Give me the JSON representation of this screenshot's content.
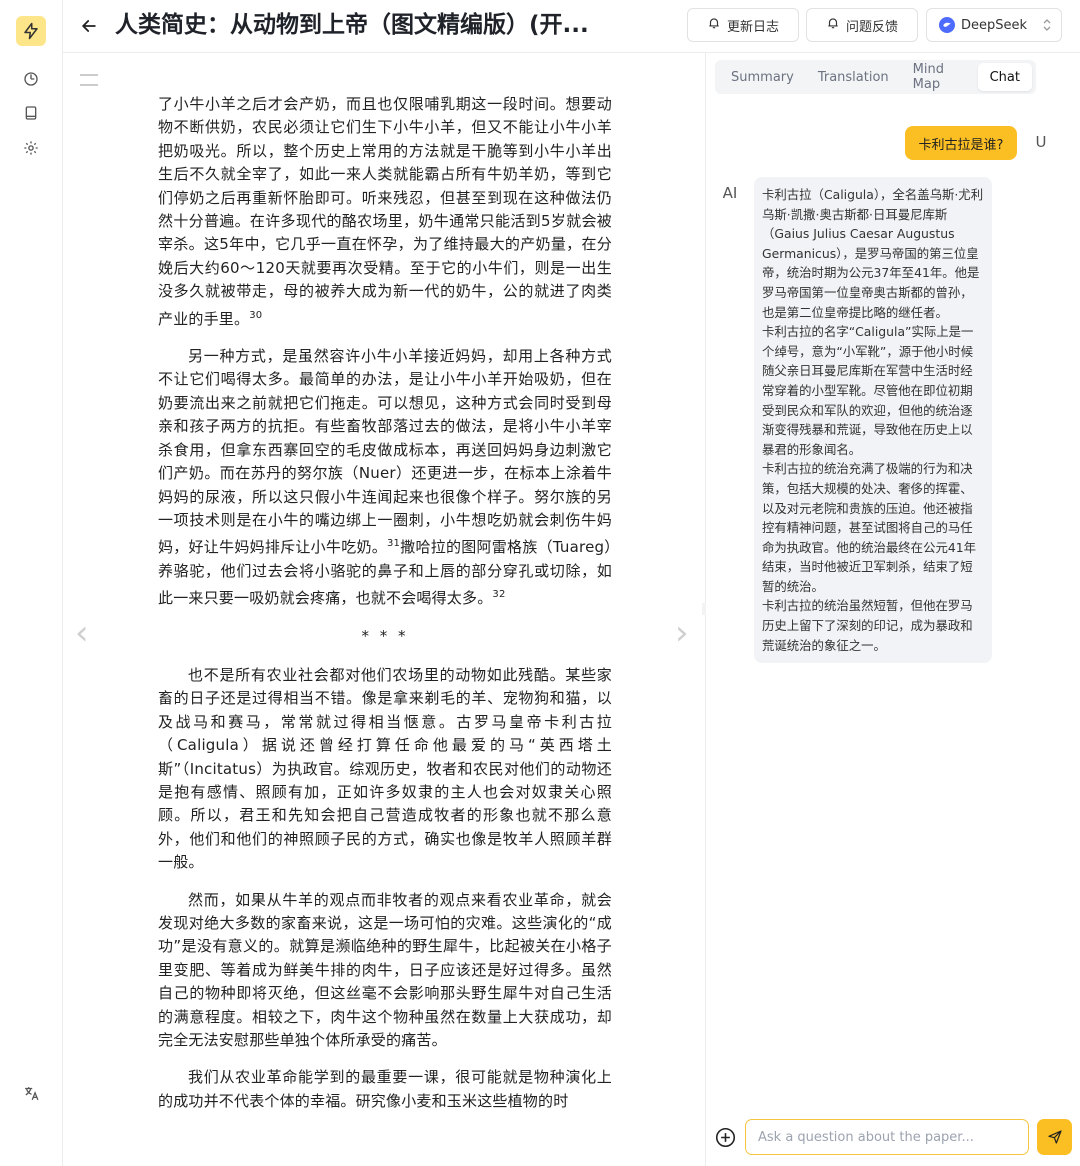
{
  "sidebar": {
    "logo_icon": "bolt-icon",
    "items": [
      {
        "icon": "history-clock-icon"
      },
      {
        "icon": "book-icon"
      },
      {
        "icon": "settings-gear-icon"
      }
    ],
    "bottom_icon": "translate-icon"
  },
  "header": {
    "title": "人类简史：从动物到上帝（图文精编版）(开...",
    "changelog_label": "更新日志",
    "feedback_label": "问题反馈",
    "model_label": "DeepSeek"
  },
  "reader": {
    "paragraphs": [
      {
        "text": "了小牛小羊之后才会产奶，而且也仅限哺乳期这一段时间。想要动物不断供奶，农民必须让它们生下小牛小羊，但又不能让小牛小羊把奶吸光。所以，整个历史上常用的方法就是干脆等到小牛小羊出生后不久就全宰了，如此一来人类就能霸占所有牛奶羊奶，等到它们停奶之后再重新怀胎即可。听来残忍，但甚至到现在这种做法仍然十分普遍。在许多现代的酪农场里，奶牛通常只能活到5岁就会被宰杀。这5年中，它几乎一直在怀孕，为了维持最大的产奶量，在分娩后大约60～120天就要再次受精。至于它的小牛们，则是一出生没多久就被带走，母的被养大成为新一代的奶牛，公的就进了肉类产业的手里。",
        "note": "30"
      },
      {
        "text": "另一种方式，是虽然容许小牛小羊接近妈妈，却用上各种方式不让它们喝得太多。最简单的办法，是让小牛小羊开始吸奶，但在奶要流出来之前就把它们拖走。可以想见，这种方式会同时受到母亲和孩子两方的抗拒。有些畜牧部落过去的做法，是将小牛小羊宰杀食用，但拿东西寨回空的毛皮做成标本，再送回妈妈身边刺激它们产奶。而在苏丹的努尔族（Nuer）还更进一步，在标本上涂着牛妈妈的尿液，所以这只假小牛连闻起来也很像个样子。努尔族的另一项技术则是在小牛的嘴边绑上一圈刺，小牛想吃奶就会刺伤牛妈妈，好让牛妈妈排斥让小牛吃奶。",
        "note": "31",
        "text2": "撒哈拉的图阿雷格族（Tuareg）养骆驼，他们过去会将小骆驼的鼻子和上唇的部分穿孔或切除，如此一来只要一吸奶就会疼痛，也就不会喝得太多。",
        "note2": "32"
      },
      {
        "text": "也不是所有农业社会都对他们农场里的动物如此残酷。某些家畜的日子还是过得相当不错。像是拿来剃毛的羊、宠物狗和猫，以及战马和赛马，常常就过得相当惬意。古罗马皇帝卡利古拉（Caligula）据说还曾经打算任命他最爱的马“英西塔土斯”（Incitatus）为执政官。综观历史，牧者和农民对他们的动物还是抱有感情、照顾有加，正如许多奴隶的主人也会对奴隶关心照顾。所以，君王和先知会把自己营造成牧者的形象也就不那么意外，他们和他们的神照顾子民的方式，确实也像是牧羊人照顾羊群一般。"
      },
      {
        "text": "然而，如果从牛羊的观点而非牧者的观点来看农业革命，就会发现对绝大多数的家畜来说，这是一场可怕的灾难。这些演化的“成功”是没有意义的。就算是濒临绝种的野生犀牛，比起被关在小格子里变肥、等着成为鲜美牛排的肉牛，日子应该还是好过得多。虽然自己的物种即将灭绝，但这丝毫不会影响那头野生犀牛对自己生活的满意程度。相较之下，肉牛这个物种虽然在数量上大获成功，却完全无法安慰那些单独个体所承受的痛苦。"
      },
      {
        "text": "我们从农业革命能学到的最重要一课，很可能就是物种演化上的成功并不代表个体的幸福。研究像小麦和玉米这些植物的时"
      }
    ],
    "separator": "* * *",
    "prev_arrow": "‹",
    "next_arrow": "›",
    "menu_icon": "menu-lines-icon"
  },
  "panel": {
    "tabs": [
      {
        "label": "Summary",
        "active": false
      },
      {
        "label": "Translation",
        "active": false
      },
      {
        "label": "Mind Map",
        "active": false
      },
      {
        "label": "Chat",
        "active": true
      }
    ],
    "user_message": "卡利古拉是谁?",
    "user_avatar": "U",
    "ai_avatar": "AI",
    "ai_message": [
      "卡利古拉（Caligula），全名盖乌斯·尤利乌斯·凯撒·奥古斯都·日耳曼尼库斯（Gaius Julius Caesar Augustus Germanicus），是罗马帝国的第三位皇帝，统治时期为公元37年至41年。他是罗马帝国第一位皇帝奥古斯都的曾孙，也是第二位皇帝提比略的继任者。",
      "卡利古拉的名字“Caligula”实际上是一个绰号，意为“小军靴”，源于他小时候随父亲日耳曼尼库斯在军营中生活时经常穿着的小型军靴。尽管他在即位初期受到民众和军队的欢迎，但他的统治逐渐变得残暴和荒诞，导致他在历史上以暴君的形象闻名。",
      "卡利古拉的统治充满了极端的行为和决策，包括大规模的处决、奢侈的挥霍、以及对元老院和贵族的压迫。他还被指控有精神问题，甚至试图将自己的马任命为执政官。他的统治最终在公元41年结束，当时他被近卫军刺杀，结束了短暂的统治。",
      "卡利古拉的统治虽然短暂，但他在罗马历史上留下了深刻的印记，成为暴政和荒诞统治的象征之一。"
    ],
    "input_placeholder": "Ask a question about the paper...",
    "accent": "#fbbf24"
  }
}
